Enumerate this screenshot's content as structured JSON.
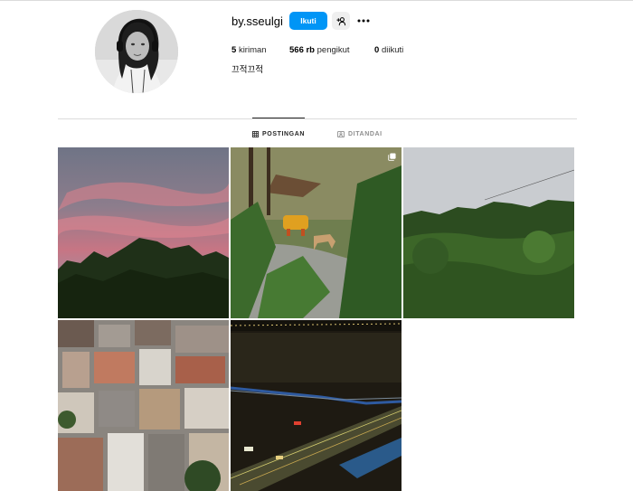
{
  "profile": {
    "username": "by.sseulgi",
    "follow_label": "Ikuti",
    "posts_count": "5",
    "posts_label": "kiriman",
    "followers_count": "566 rb",
    "followers_label": "pengikut",
    "following_count": "0",
    "following_label": "diikuti",
    "bio": "끄적끄적"
  },
  "tabs": [
    {
      "label": "POSTINGAN",
      "active": true
    },
    {
      "label": "DITANDAI",
      "active": false
    }
  ],
  "posts": [
    {
      "subject": "pink sunset sky over trees"
    },
    {
      "subject": "dog on path in park",
      "multi": true
    },
    {
      "subject": "green forested hill"
    },
    {
      "subject": "dense city rooftops"
    },
    {
      "subject": "bridge highway at night"
    }
  ],
  "colors": {
    "follow_button": "#0095f6",
    "divider": "#dbdbdb",
    "inactive_tab": "#8e8e8e"
  }
}
